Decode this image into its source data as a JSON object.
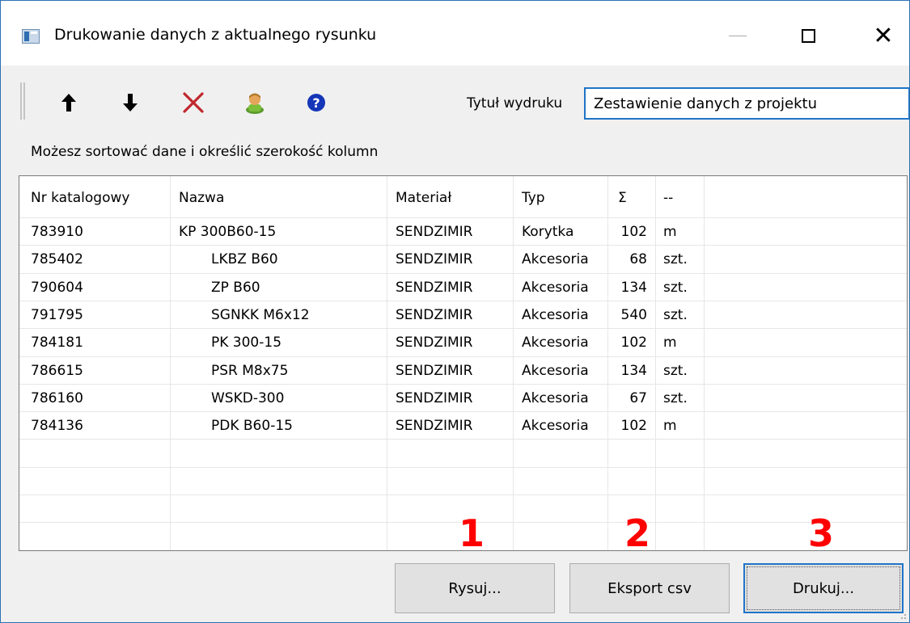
{
  "window": {
    "title": "Drukowanie danych z aktualnego rysunku",
    "controls": {
      "minimize": "—",
      "maximize": "☐",
      "close": "✕"
    }
  },
  "toolbar": {
    "icons": [
      "arrow-up-icon",
      "arrow-down-icon",
      "delete-icon",
      "user-icon",
      "help-icon"
    ],
    "print_title_label": "Tytuł wydruku",
    "print_title_value": "Zestawienie danych z projektu"
  },
  "hint": "Możesz sortować dane i określić szerokość kolumn",
  "table": {
    "columns": [
      "Nr katalogowy",
      "Nazwa",
      "Materiał",
      "Typ",
      "Σ",
      "--"
    ],
    "rows": [
      [
        "783910",
        "KP 300B60-15",
        "SENDZIMIR",
        "Korytka",
        "102",
        "m"
      ],
      [
        "785402",
        "LKBZ B60",
        "SENDZIMIR",
        "Akcesoria",
        "68",
        "szt."
      ],
      [
        "790604",
        "ZP B60",
        "SENDZIMIR",
        "Akcesoria",
        "134",
        "szt."
      ],
      [
        "791795",
        "SGNKK M6x12",
        "SENDZIMIR",
        "Akcesoria",
        "540",
        "szt."
      ],
      [
        "784181",
        "PK 300-15",
        "SENDZIMIR",
        "Akcesoria",
        "102",
        "m"
      ],
      [
        "786615",
        "PSR M8x75",
        "SENDZIMIR",
        "Akcesoria",
        "134",
        "szt."
      ],
      [
        "786160",
        "WSKD-300",
        "SENDZIMIR",
        "Akcesoria",
        "67",
        "szt."
      ],
      [
        "784136",
        "PDK B60-15",
        "SENDZIMIR",
        "Akcesoria",
        "102",
        "m"
      ]
    ]
  },
  "buttons": {
    "draw": "Rysuj...",
    "export": "Eksport csv",
    "print": "Drukuj..."
  },
  "annotations": [
    "1",
    "2",
    "3"
  ],
  "colors": {
    "accent": "#1f74c8",
    "annotation": "#ff0000"
  }
}
